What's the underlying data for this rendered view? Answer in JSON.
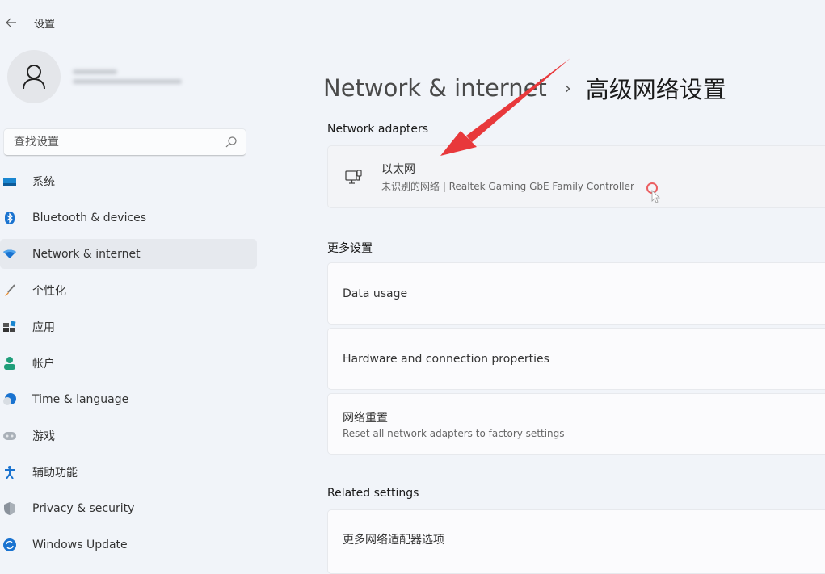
{
  "app": {
    "title": "设置",
    "back_label": "←"
  },
  "search": {
    "placeholder": "查找设置"
  },
  "sidebar": {
    "items": [
      {
        "label": "系统",
        "icon": "system-icon",
        "active": false
      },
      {
        "label": "Bluetooth & devices",
        "icon": "bluetooth-icon",
        "active": false
      },
      {
        "label": "Network & internet",
        "icon": "wifi-icon",
        "active": true
      },
      {
        "label": "个性化",
        "icon": "brush-icon",
        "active": false
      },
      {
        "label": "应用",
        "icon": "apps-icon",
        "active": false
      },
      {
        "label": "帐户",
        "icon": "account-icon",
        "active": false
      },
      {
        "label": "Time & language",
        "icon": "globe-clock-icon",
        "active": false
      },
      {
        "label": "游戏",
        "icon": "gamepad-icon",
        "active": false
      },
      {
        "label": "辅助功能",
        "icon": "accessibility-icon",
        "active": false
      },
      {
        "label": "Privacy & security",
        "icon": "shield-icon",
        "active": false
      },
      {
        "label": "Windows Update",
        "icon": "update-icon",
        "active": false
      }
    ]
  },
  "breadcrumb": {
    "parent": "Network & internet",
    "separator": "›",
    "current": "高级网络设置"
  },
  "network_adapters": {
    "title": "Network adapters",
    "adapter": {
      "name": "以太网",
      "description": "未识别的网络 | Realtek Gaming GbE Family Controller"
    }
  },
  "more_settings": {
    "title": "更多设置",
    "items": [
      {
        "title": "Data usage",
        "subtitle": ""
      },
      {
        "title": "Hardware and connection properties",
        "subtitle": ""
      },
      {
        "title": "网络重置",
        "subtitle": "Reset all network adapters to factory settings"
      }
    ]
  },
  "related_settings": {
    "title": "Related settings",
    "items": [
      {
        "title": "更多网络适配器选项"
      }
    ]
  },
  "colors": {
    "accent": "#0067c0",
    "annotation_arrow": "#e8383b",
    "background": "#f1f4f9"
  }
}
